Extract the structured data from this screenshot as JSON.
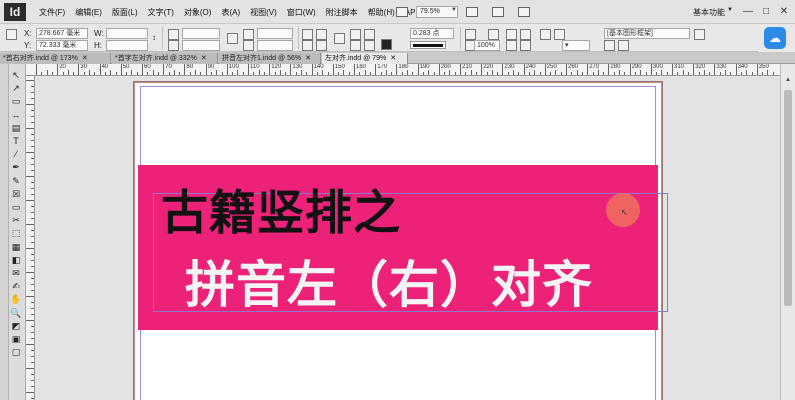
{
  "app": {
    "logo": "Id",
    "menus": [
      "文件(F)",
      "编辑(E)",
      "版面(L)",
      "文字(T)",
      "对象(O)",
      "表(A)",
      "视图(V)",
      "窗口(W)",
      "附注脚本",
      "帮助(H)",
      "API"
    ],
    "zoom": "79.5%",
    "workspace": "基本功能",
    "window_buttons": [
      "—",
      "□",
      "✕"
    ]
  },
  "control_bar": {
    "x_label": "X:",
    "x_value": "278.667 毫米",
    "y_label": "Y:",
    "y_value": "72.333 毫米",
    "w_label": "W:",
    "h_label": "H:",
    "stroke_weight": "0.283 点",
    "opacity": "100%",
    "style": "[基本图形框架]",
    "ref_point": "↕",
    "fill_caret": "▾"
  },
  "tabs": [
    {
      "label": "*首右对齐.indd @ 173%",
      "active": false
    },
    {
      "label": "*首字左对齐.indd @ 332%",
      "active": false
    },
    {
      "label": "拼音左对齐1.indd @ 56%",
      "active": false
    },
    {
      "label": "左对齐.indd @ 79%",
      "active": true
    }
  ],
  "ruler": {
    "labels": [
      "",
      "20",
      "30",
      "40",
      "50",
      "60",
      "70",
      "80",
      "90",
      "100",
      "110",
      "120",
      "130",
      "140",
      "150",
      "160",
      "170",
      "180",
      "190",
      "200",
      "210",
      "220",
      "230",
      "240",
      "250",
      "260",
      "270",
      "280",
      "290",
      "300",
      "310",
      "320",
      "330",
      "340",
      "350"
    ]
  },
  "document": {
    "line1": "古籍竖排之",
    "line2": "拼音左（右）对齐",
    "band_color": "#ec2178",
    "line1_color": "#111111",
    "line2_color": "#f4f4f4"
  },
  "tools": [
    "select",
    "direct-select",
    "page",
    "gap",
    "content-collector",
    "type",
    "line",
    "pen",
    "pencil",
    "rectangle-frame",
    "rectangle",
    "scissors",
    "free-transform",
    "gradient",
    "gradient-feather",
    "note",
    "eyedropper",
    "hand",
    "zoom",
    "fill-stroke",
    "apply-color",
    "view-mode"
  ]
}
